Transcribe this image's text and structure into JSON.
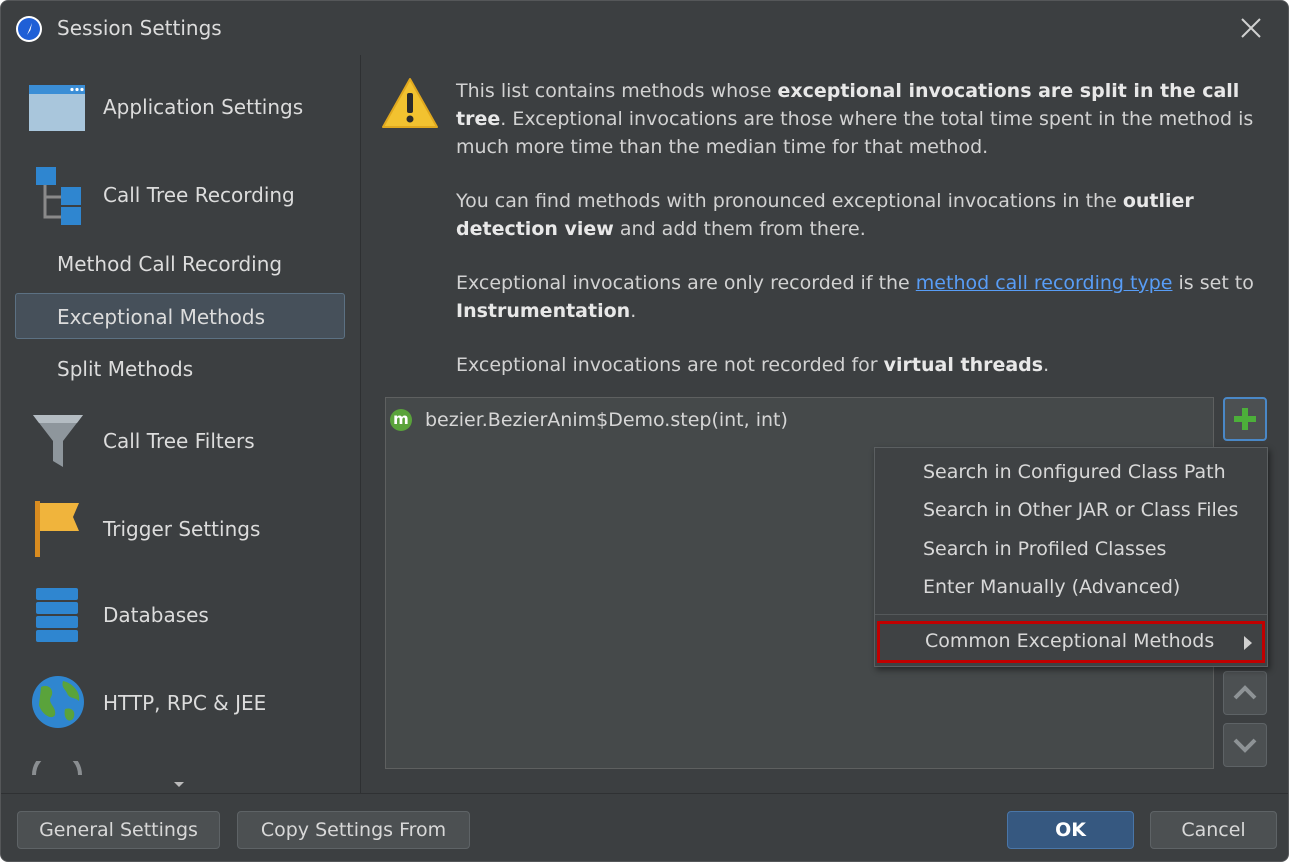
{
  "window": {
    "title": "Session Settings",
    "colors": {
      "background": "#3c3f41",
      "accent": "#4a88c7",
      "link": "#589df6",
      "highlight_border": "#c00000"
    }
  },
  "sidebar": {
    "items": [
      {
        "label": "Application Settings",
        "icon": "application-window-icon"
      },
      {
        "label": "Call Tree Recording",
        "icon": "call-tree-icon"
      },
      {
        "label": "Method Call Recording",
        "icon": ""
      },
      {
        "label": "Exceptional Methods",
        "icon": "",
        "selected": true
      },
      {
        "label": "Split Methods",
        "icon": ""
      },
      {
        "label": "Call Tree Filters",
        "icon": "funnel-icon"
      },
      {
        "label": "Trigger Settings",
        "icon": "flag-icon"
      },
      {
        "label": "Databases",
        "icon": "database-icon"
      },
      {
        "label": "HTTP, RPC & JEE",
        "icon": "globe-icon"
      }
    ]
  },
  "info": {
    "p1_before": "This list contains methods whose ",
    "p1_bold": "exceptional invocations are split in the call tree",
    "p1_after": ". Exceptional invocations are those where the total time spent in the method is much more time than the median time for that method.",
    "p2_before": "You can find methods with pronounced exceptional invocations in the ",
    "p2_bold": "outlier detection view",
    "p2_after": " and add them from there.",
    "p3_before": "Exceptional invocations are only recorded if the ",
    "p3_link": "method call recording type",
    "p3_middle": " is set to ",
    "p3_bold": "Instrumentation",
    "p3_after": ".",
    "p4_before": "Exceptional invocations are not recorded for ",
    "p4_bold": "virtual threads",
    "p4_after": "."
  },
  "method_list": {
    "items": [
      {
        "badge": "m",
        "text": "bezier.BezierAnim$Demo.step(int, int)"
      }
    ]
  },
  "add_menu": {
    "items": [
      "Search in Configured Class Path",
      "Search in Other JAR or Class Files",
      "Search in Profiled Classes",
      "Enter Manually (Advanced)"
    ],
    "submenu_label": "Common Exceptional Methods"
  },
  "footer": {
    "general_settings": "General Settings",
    "copy_settings_from": "Copy Settings From",
    "ok": "OK",
    "cancel": "Cancel"
  }
}
